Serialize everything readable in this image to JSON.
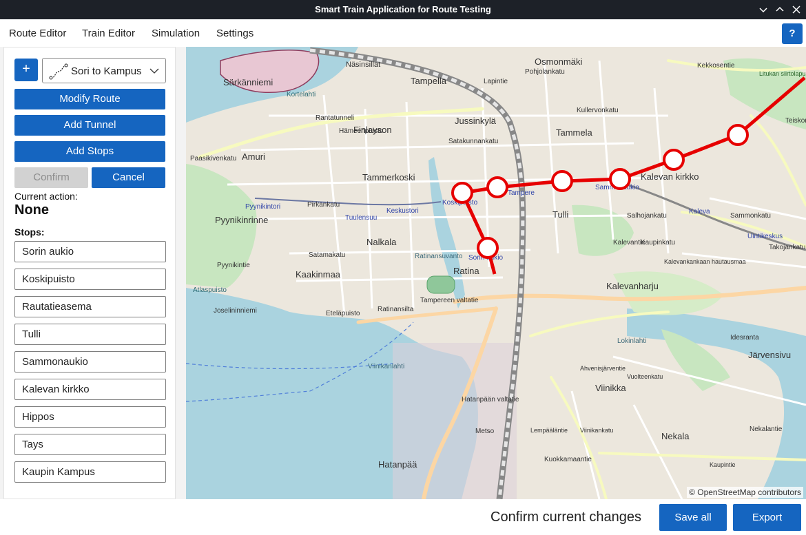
{
  "window": {
    "title": "Smart Train Application for Route Testing"
  },
  "menu": {
    "items": [
      "Route Editor",
      "Train Editor",
      "Simulation",
      "Settings"
    ],
    "help": "?"
  },
  "sidebar": {
    "add_label": "+",
    "route_select": {
      "value": "Sori to Kampus"
    },
    "buttons": {
      "modify": "Modify Route",
      "tunnel": "Add Tunnel",
      "stops": "Add Stops",
      "confirm": "Confirm",
      "cancel": "Cancel"
    },
    "current_action_label": "Current action:",
    "current_action_value": "None",
    "stops_label": "Stops:",
    "stops": [
      "Sorin aukio",
      "Koskipuisto",
      "Rautatieasema",
      "Tulli",
      "Sammonaukio",
      "Kalevan kirkko",
      "Hippos",
      "Tays",
      "Kaupin Kampus"
    ]
  },
  "map": {
    "attribution": "© OpenStreetMap contributors",
    "labels": [
      "Särkänniemi",
      "Näsinsillat",
      "Tampella",
      "Osmonmäki",
      "Pohjolankatu",
      "Kullervonkatu",
      "Amuri",
      "Finlayson",
      "Jussinkylä",
      "Tammela",
      "Tammerkoski",
      "Pyynikintori",
      "Pyynikinrinne",
      "Tuulensuu",
      "Keskustori",
      "Koskipuisto",
      "Tampere",
      "Sammonaukio",
      "Tulli",
      "Kalevan kirkko",
      "Nalkala",
      "Sorin aukio",
      "Ratina",
      "Kaakinmaa",
      "Kalevanharju",
      "Kalevankankaan hautausmaa",
      "Kaleva",
      "Uintikeskus",
      "Viinikka",
      "Hatanpää",
      "Nekala",
      "Järvensivu",
      "Metso",
      "Atlaspuisto",
      "Joselininniemi",
      "Viinikanlahti",
      "Ratinansuvanto",
      "Ratinansilta",
      "Tampereen valtatie",
      "Kaupinkatu",
      "Kalevantie",
      "Lokinlahti",
      "Lapintie",
      "Paasikivenkatu",
      "Rantatunneli",
      "Satakunnankatu",
      "Hämeenpuisto",
      "Pirkankatu",
      "Satamakatu",
      "Eteläpuisto",
      "Pyynikintie",
      "Hatanpään valtatie",
      "Kuokkamaantie",
      "Nekalantie",
      "Idesranta",
      "Takojankatu",
      "Sammonkatu",
      "Salhojankatu",
      "Teiskontie",
      "Kekkosentie",
      "Litukan siirtolapuutarha",
      "Kortelahti",
      "Ahvenisjärventie",
      "Lempääläntie",
      "Viinikankatu",
      "Vuolteenkatu",
      "Kaupintie"
    ],
    "route": {
      "color": "#e60000"
    }
  },
  "footer": {
    "confirm_text": "Confirm current changes",
    "save_all": "Save all",
    "export": "Export"
  }
}
